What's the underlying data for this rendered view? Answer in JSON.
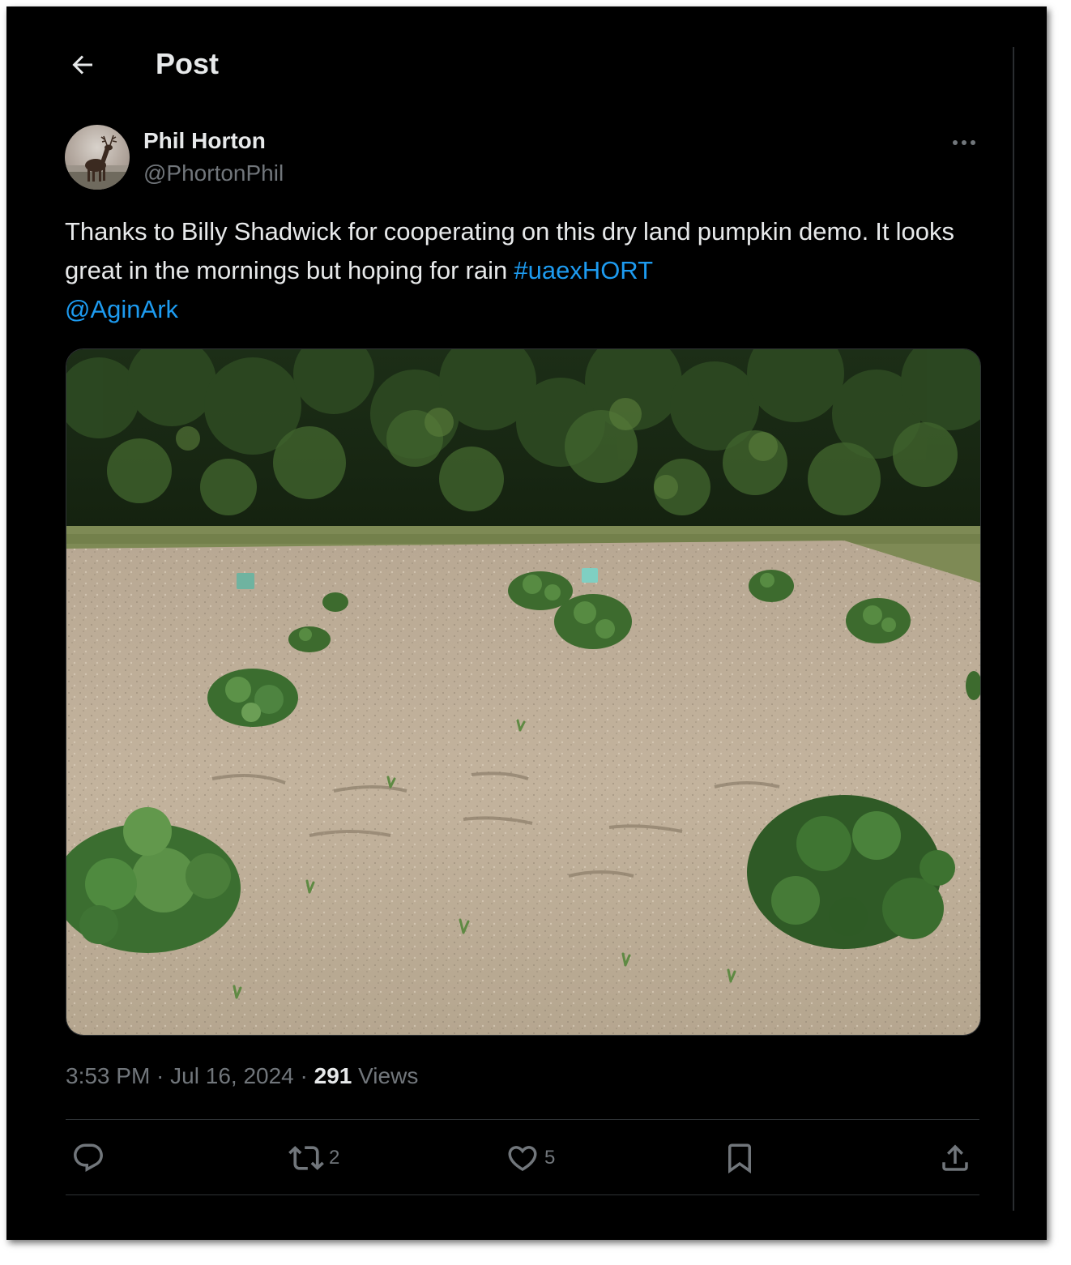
{
  "header": {
    "back_icon": "arrow-left-icon",
    "title": "Post"
  },
  "author": {
    "display_name": "Phil Horton",
    "handle": "@PhortonPhil",
    "avatar_icon": "deer-avatar",
    "more_icon": "more-horizontal-icon"
  },
  "tweet": {
    "text_part1": "Thanks to Billy Shadwick for cooperating on this dry land pumpkin demo. It looks great in the mornings but hoping for rain ",
    "hashtag": "#uaexHORT",
    "mention": "@AginArk"
  },
  "media": {
    "kind": "photo"
  },
  "meta": {
    "time": "3:53 PM",
    "sep1": " · ",
    "date": "Jul 16, 2024",
    "sep2": " · ",
    "views_count": "291",
    "views_label": " Views"
  },
  "actions": {
    "reply": {
      "icon": "reply-icon",
      "count": ""
    },
    "retweet": {
      "icon": "retweet-icon",
      "count": "2"
    },
    "like": {
      "icon": "heart-icon",
      "count": "5"
    },
    "bookmark": {
      "icon": "bookmark-icon",
      "count": ""
    },
    "share": {
      "icon": "share-icon",
      "count": ""
    }
  },
  "colors": {
    "background": "#000000",
    "text": "#e7e9ea",
    "secondary": "#71767b",
    "link": "#1d9bf0",
    "divider": "#2f3336"
  }
}
